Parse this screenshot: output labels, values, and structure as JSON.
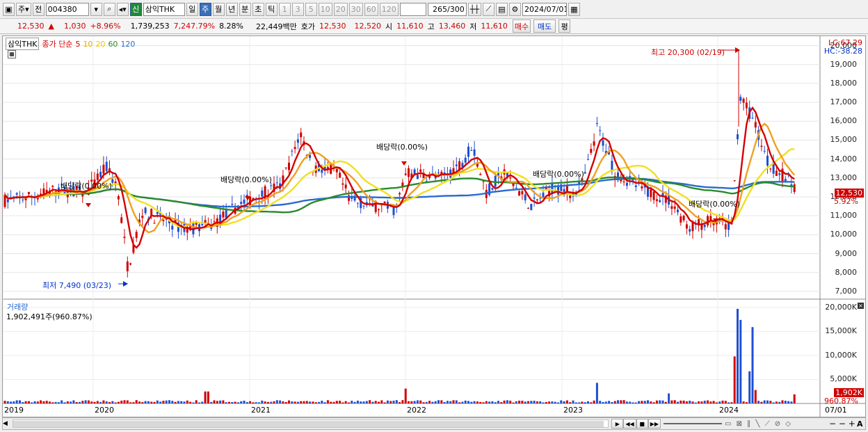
{
  "toolbar": {
    "market": "주",
    "prev": "전",
    "code": "004380",
    "new_badge": "신",
    "name": "삼익THK",
    "periods": [
      "일",
      "주",
      "월",
      "년",
      "분",
      "초",
      "틱"
    ],
    "active_period": "주",
    "minutes": [
      "1",
      "3",
      "5",
      "10",
      "20",
      "30",
      "60",
      "120"
    ],
    "count": "265",
    "count_max": "/300",
    "date": "2024/07/01"
  },
  "info": {
    "price": "12,530",
    "arrow": "▲",
    "change": "1,030",
    "rate": "+8.96%",
    "volume": "1,739,253",
    "vol_rate": "7,247.79%",
    "turnover": "8.28%",
    "amount": "22,449백만",
    "hoga_label": "호가",
    "ask": "12,530",
    "bid": "12,520",
    "open_label": "시",
    "open": "11,610",
    "high_label": "고",
    "high": "13,460",
    "low_label": "저",
    "low": "11,610",
    "buy": "매수",
    "sell": "매도",
    "eval": "평"
  },
  "legend": {
    "name": "삼익THK",
    "title": "종가 단순",
    "ma": [
      "5",
      "10",
      "20",
      "60",
      "120"
    ],
    "ma_colors": [
      "#d40000",
      "#f0c400",
      "#f4d400",
      "#2a8a2a",
      "#2a6ad0"
    ]
  },
  "price_axis": {
    "labels": [
      "20,000",
      "19,000",
      "18,000",
      "17,000",
      "16,000",
      "15,000",
      "14,000",
      "13,000",
      "12,000",
      "11,000",
      "10,000",
      "9,000",
      "8,000",
      "7,000"
    ],
    "lc": "LC:67.29",
    "hc": "HC:-38.28",
    "cur_price": "12,530",
    "cur_rate": "5.92%"
  },
  "annotations": {
    "high": "최고 20,300 (02/19)",
    "low": "최저 7,490 (03/23)",
    "divs": [
      "배당락(0.00%)",
      "배당락(0.00%)",
      "배당락(0.00%)",
      "배당락(0.00%)",
      "배당락(0.00%)"
    ]
  },
  "volume": {
    "label": "거래량",
    "value": "1,902,491주(960.87%)",
    "axis": [
      "20,000K",
      "15,000K",
      "10,000K",
      "5,000K"
    ],
    "cur": "1,902K",
    "cur_rate": "960.87%"
  },
  "xaxis": {
    "labels": [
      "2019",
      "2020",
      "2021",
      "2022",
      "2023",
      "2024",
      "07/01"
    ]
  },
  "chart_data": {
    "type": "candlestick",
    "title": "삼익THK",
    "ylim": [
      6700,
      20500
    ],
    "x": [
      "2019",
      "2020",
      "2021",
      "2022",
      "2023",
      "2024",
      "07/01"
    ],
    "high": {
      "value": 20300,
      "date": "02/19"
    },
    "low": {
      "value": 7490,
      "date": "03/23"
    },
    "last": {
      "close": 12530,
      "open": 11610,
      "high": 13460,
      "low": 11610
    },
    "volume_axis": [
      0,
      20000
    ]
  }
}
